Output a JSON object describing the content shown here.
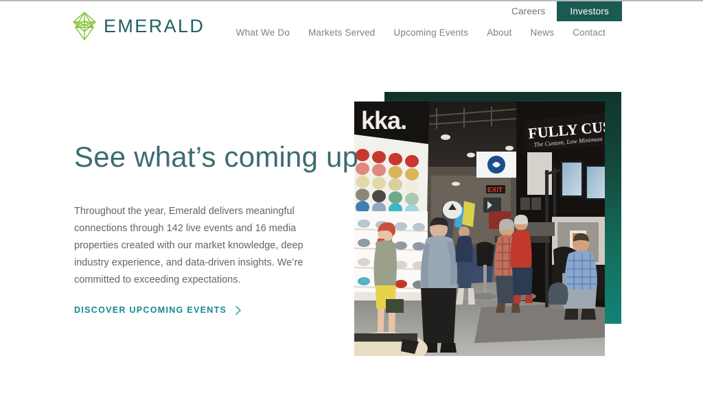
{
  "brand": {
    "name": "EMERALD",
    "logo_icon": "emerald-diamond-logo",
    "logo_green": "#8CC63F",
    "wordmark_color": "#1f5f63"
  },
  "header": {
    "utility_nav": [
      {
        "label": "Careers",
        "active": false
      },
      {
        "label": "Investors",
        "active": true
      }
    ],
    "main_nav": [
      {
        "label": "What We Do"
      },
      {
        "label": "Markets Served"
      },
      {
        "label": "Upcoming Events"
      },
      {
        "label": "About"
      },
      {
        "label": "News"
      },
      {
        "label": "Contact"
      }
    ],
    "active_pill_color": "#195b52"
  },
  "hero": {
    "title": "See what’s coming up",
    "title_color": "#3d6b72",
    "body": "Throughout the year, Emerald delivers meaningful connections through 142 live events and 16 media properties created with our market knowledge, deep industry experience, and data-driven insights. We’re committed to exceeding expectations.",
    "cta_label": "DISCOVER UPCOMING EVENTS",
    "cta_icon": "chevron-right-icon",
    "cta_color": "#14888f",
    "stats": {
      "live_events": "142",
      "media_properties": "16"
    },
    "media": {
      "photo_alt": "Trade show floor with cap display wall and FULLY CUSTOM booth",
      "photo_signage_left": "kka.",
      "photo_signage_right": "FULLY CUSTOM",
      "photo_signage_right_sub": "The Custom, Low Minimum",
      "photo_exit_sign": "EXIT",
      "panel_gradient_from": "#0f3329",
      "panel_gradient_to": "#0f8377"
    }
  }
}
